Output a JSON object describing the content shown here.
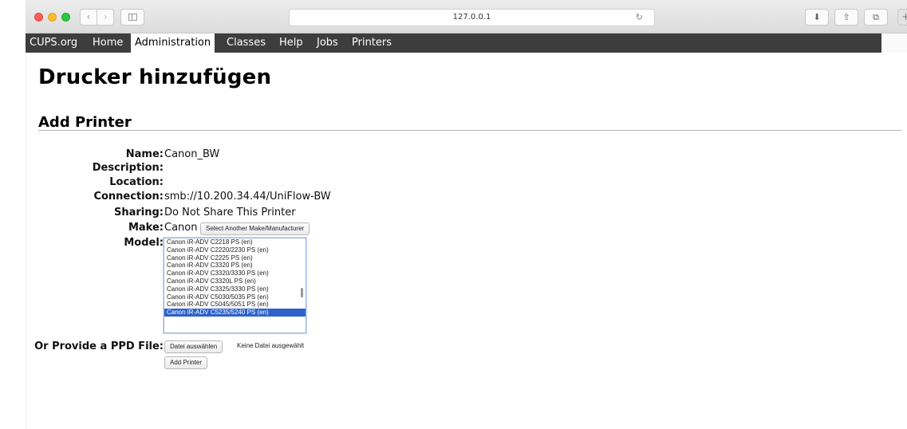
{
  "browser": {
    "url": "127.0.0.1",
    "reload_icon": "↻",
    "back_icon": "‹",
    "forward_icon": "›",
    "download_icon": "⬇",
    "share_icon": "⇧",
    "tabs_icon": "⧉",
    "plus_icon": "+"
  },
  "nav": {
    "items": [
      {
        "label": "CUPS.org"
      },
      {
        "label": "Home"
      },
      {
        "label": "Administration"
      },
      {
        "label": "Classes"
      },
      {
        "label": "Help"
      },
      {
        "label": "Jobs"
      },
      {
        "label": "Printers"
      }
    ],
    "active": "Administration"
  },
  "page": {
    "title": "Drucker hinzufügen",
    "section_title": "Add Printer"
  },
  "form": {
    "name_label": "Name:",
    "name_value": "Canon_BW",
    "description_label": "Description:",
    "location_label": "Location:",
    "connection_label": "Connection:",
    "connection_value": "smb://10.200.34.44/UniFlow-BW",
    "sharing_label": "Sharing:",
    "sharing_value": "Do Not Share This Printer",
    "make_label": "Make:",
    "make_value": "Canon",
    "select_make_button": "Select Another Make/Manufacturer",
    "model_label": "Model:",
    "models": [
      "Canon iR-ADV C2218 PS (en)",
      "Canon iR-ADV C2220/2230 PS (en)",
      "Canon iR-ADV C2225 PS (en)",
      "Canon iR-ADV C3320 PS (en)",
      "Canon iR-ADV C3320/3330 PS (en)",
      "Canon iR-ADV C3320L PS (en)",
      "Canon iR-ADV C3325/3330 PS (en)",
      "Canon iR-ADV C5030/5035 PS (en)",
      "Canon iR-ADV C5045/5051 PS (en)",
      "Canon iR-ADV C5235/5240 PS (en)"
    ],
    "selected_model": "Canon iR-ADV C5235/5240 PS (en)",
    "ppd_label": "Or Provide a PPD File:",
    "choose_file_button": "Datei auswählen",
    "no_file_text": "Keine Datei ausgewählt",
    "add_printer_button": "Add Printer"
  }
}
